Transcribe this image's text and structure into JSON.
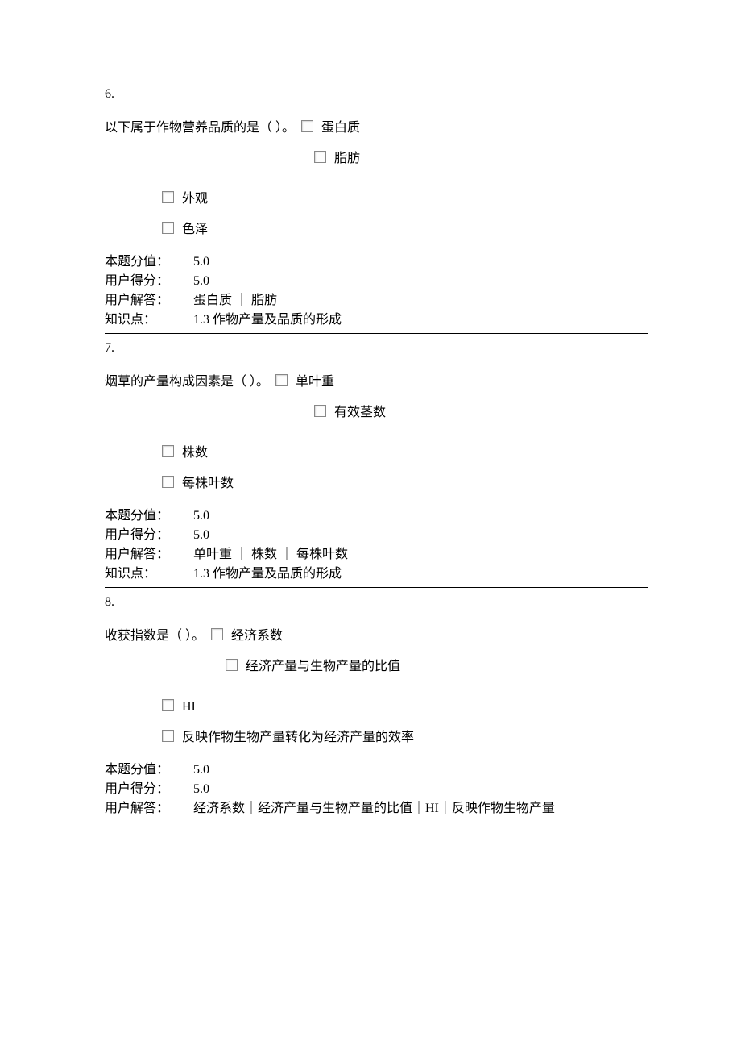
{
  "questions": [
    {
      "number": "6.",
      "stem": "以下属于作物营养品质的是（ ）。",
      "options": [
        "蛋白质",
        "脂肪",
        "外观",
        "色泽"
      ],
      "meta": {
        "score_label": "本题分值：",
        "score_value": "5.0",
        "user_score_label": "用户得分：",
        "user_score_value": "5.0",
        "answer_label": "用户解答：",
        "answer_value": "蛋白质 ｜ 脂肪",
        "kp_label": "知识点：",
        "kp_value": "1.3 作物产量及品质的形成"
      }
    },
    {
      "number": "7.",
      "stem": "烟草的产量构成因素是（ ）。",
      "options": [
        "单叶重",
        "有效茎数",
        "株数",
        "每株叶数"
      ],
      "meta": {
        "score_label": "本题分值：",
        "score_value": "5.0",
        "user_score_label": "用户得分：",
        "user_score_value": "5.0",
        "answer_label": "用户解答：",
        "answer_value": "单叶重 ｜ 株数 ｜ 每株叶数",
        "kp_label": "知识点：",
        "kp_value": "1.3 作物产量及品质的形成"
      }
    },
    {
      "number": "8.",
      "stem": "收获指数是（ ）。",
      "options": [
        "经济系数",
        "经济产量与生物产量的比值",
        "HI",
        "反映作物生物产量转化为经济产量的效率"
      ],
      "meta": {
        "score_label": "本题分值：",
        "score_value": "5.0",
        "user_score_label": "用户得分：",
        "user_score_value": "5.0",
        "answer_label": "用户解答：",
        "answer_value": "经济系数｜经济产量与生物产量的比值｜HI｜反映作物生物产量"
      }
    }
  ]
}
